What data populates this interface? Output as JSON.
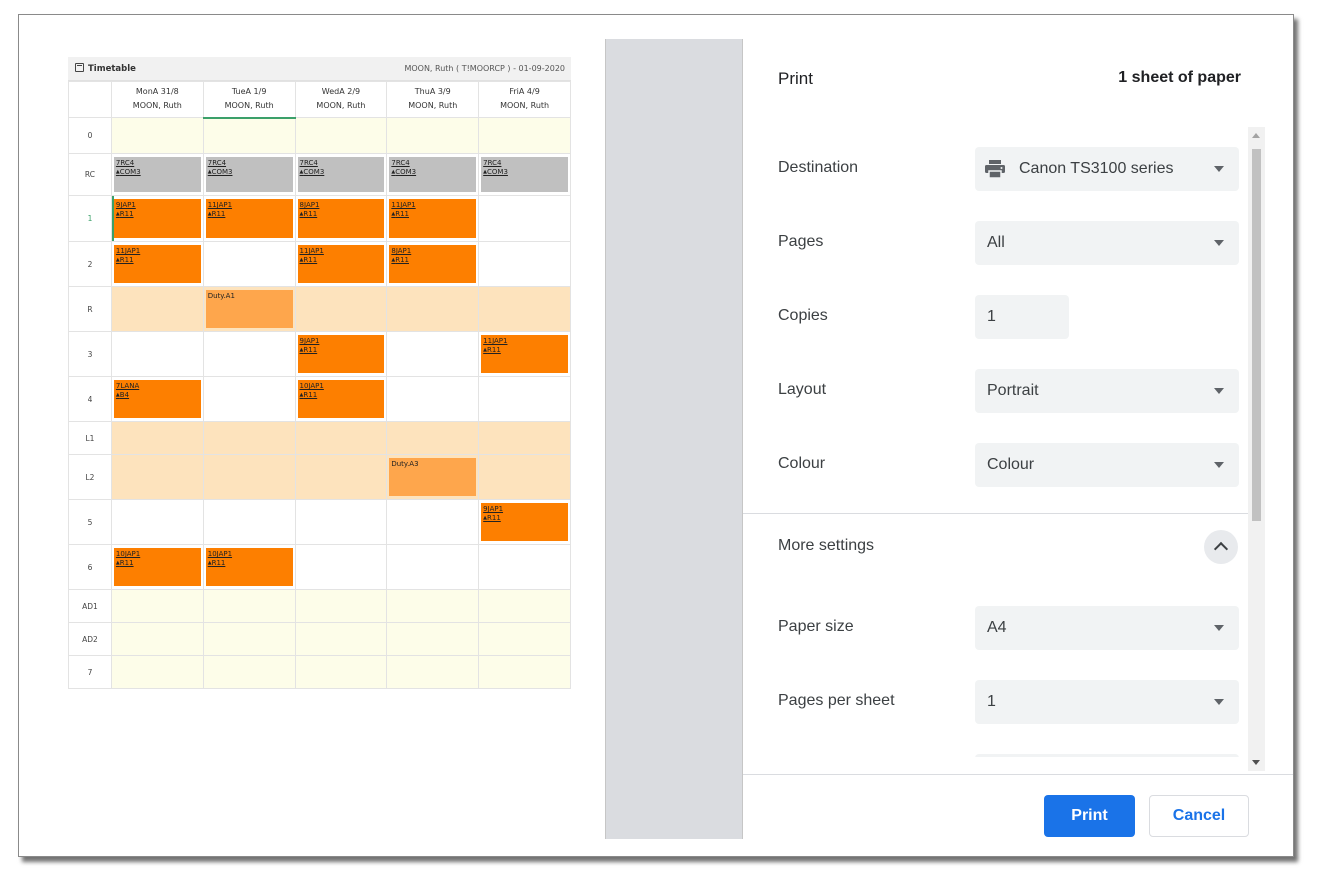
{
  "timetable": {
    "title": "Timetable",
    "owner": "MOON, Ruth ( T!MOORCP ) - 01-09-2020",
    "days": [
      {
        "name": "MonA 31/8",
        "teacher": "MOON, Ruth"
      },
      {
        "name": "TueA 1/9",
        "teacher": "MOON, Ruth"
      },
      {
        "name": "WedA 2/9",
        "teacher": "MOON, Ruth"
      },
      {
        "name": "ThuA 3/9",
        "teacher": "MOON, Ruth"
      },
      {
        "name": "FriA 4/9",
        "teacher": "MOON, Ruth"
      }
    ],
    "periods": [
      "0",
      "RC",
      "1",
      "2",
      "R",
      "3",
      "4",
      "L1",
      "L2",
      "5",
      "6",
      "AD1",
      "AD2",
      "7"
    ],
    "lessons": {
      "rc": {
        "class": "7RC4",
        "room": "COM3"
      },
      "p1_mon": {
        "class": "9JAP1",
        "room": "R11"
      },
      "p1_tue": {
        "class": "11JAP1",
        "room": "R11"
      },
      "p1_wed": {
        "class": "8JAP1",
        "room": "R11"
      },
      "p1_thu": {
        "class": "11JAP1",
        "room": "R11"
      },
      "p2_mon": {
        "class": "11JAP1",
        "room": "R11"
      },
      "p2_wed": {
        "class": "11JAP1",
        "room": "R11"
      },
      "p2_thu": {
        "class": "8JAP1",
        "room": "R11"
      },
      "r_tue": {
        "label": "Duty.A1"
      },
      "p3_wed": {
        "class": "9JAP1",
        "room": "R11"
      },
      "p3_fri": {
        "class": "11JAP1",
        "room": "R11"
      },
      "p4_mon": {
        "class": "7LANA",
        "room": "B4"
      },
      "p4_wed": {
        "class": "10JAP1",
        "room": "R11"
      },
      "l2_thu": {
        "label": "Duty.A3"
      },
      "p5_fri": {
        "class": "9JAP1",
        "room": "R11"
      },
      "p6_mon": {
        "class": "10JAP1",
        "room": "R11"
      },
      "p6_tue": {
        "class": "10JAP1",
        "room": "R11"
      }
    }
  },
  "print": {
    "title": "Print",
    "sheets": "1 sheet of paper",
    "destination": {
      "label": "Destination",
      "value": "Canon TS3100 series"
    },
    "pages": {
      "label": "Pages",
      "value": "All"
    },
    "copies": {
      "label": "Copies",
      "value": "1"
    },
    "layout": {
      "label": "Layout",
      "value": "Portrait"
    },
    "colour": {
      "label": "Colour",
      "value": "Colour"
    },
    "more_settings": "More settings",
    "paper_size": {
      "label": "Paper size",
      "value": "A4"
    },
    "pages_per_sheet": {
      "label": "Pages per sheet",
      "value": "1"
    },
    "print_button": "Print",
    "cancel_button": "Cancel"
  },
  "colors": {
    "accent": "#1a73e8",
    "lesson": "#fd7f00",
    "registration": "#c0c0c0",
    "duty": "#fea64c",
    "break_row": "#fde3bd",
    "empty_row": "#fdfde9",
    "current_period": "#3ba06a"
  }
}
